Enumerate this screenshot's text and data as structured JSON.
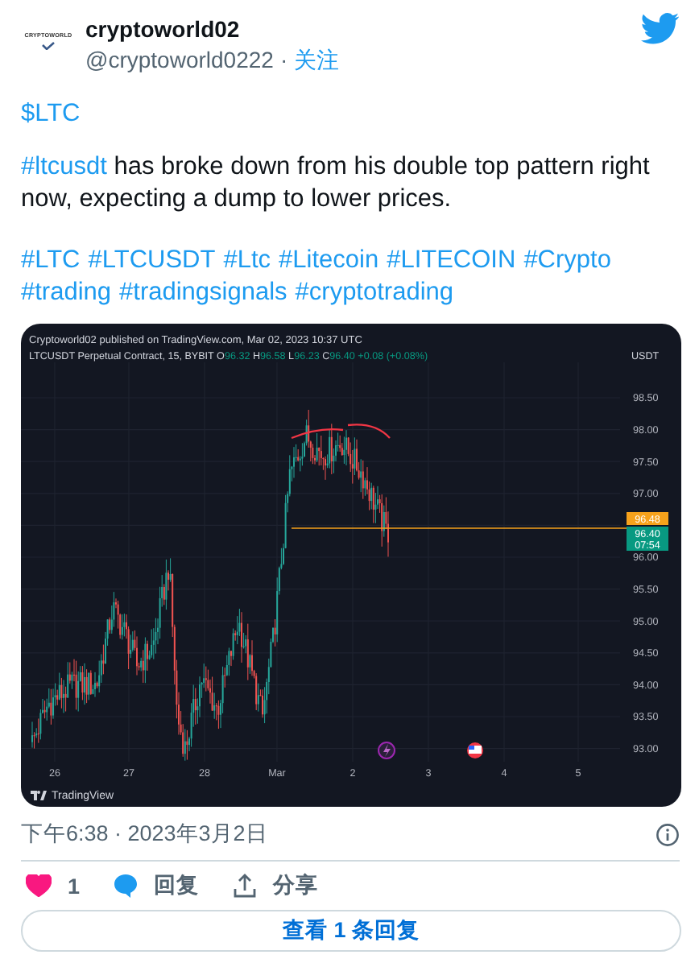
{
  "author": {
    "avatar_text": "CRYPTOWORLD",
    "name": "cryptoworld02",
    "handle": "@cryptoworld0222",
    "separator": "·",
    "follow": "关注"
  },
  "body": {
    "cashtag": "$LTC",
    "mention_tag": "#ltcusdt",
    "text": " has broke down from his double top pattern right now, expecting a dump to lower prices.",
    "hashtags": [
      "#LTC",
      "#LTCUSDT",
      "#Ltc",
      "#Litecoin",
      "#LITECOIN",
      "#Crypto",
      "#trading",
      "#tradingsignals",
      "#cryptotrading"
    ]
  },
  "chart": {
    "published": "Cryptoworld02 published on TradingView.com, Mar 02, 2023 10:37 UTC",
    "symbol": "LTCUSDT Perpetual Contract, 15, BYBIT",
    "ohlc": [
      {
        "label": "O",
        "value": "96.32"
      },
      {
        "label": "H",
        "value": "96.58"
      },
      {
        "label": "L",
        "value": "96.23"
      },
      {
        "label": "C",
        "value": "96.40"
      }
    ],
    "change": "+0.08 (+0.08%)",
    "currency": "USDT",
    "yticks": [
      "98.50",
      "98.00",
      "97.50",
      "97.00",
      "96.00",
      "95.50",
      "95.00",
      "94.50",
      "94.00",
      "93.50",
      "93.00"
    ],
    "xticks": [
      "26",
      "27",
      "28",
      "Mar",
      "2",
      "3",
      "4",
      "5"
    ],
    "price_tags": [
      {
        "text": "96.48",
        "color": "#f7a21b"
      },
      {
        "text": "96.40",
        "color": "#089981"
      },
      {
        "text": "07:54",
        "color": "#089981"
      }
    ],
    "footer": "TradingView"
  },
  "timestamp": "下午6:38 · 2023年3月2日",
  "actions": [
    {
      "kind": "like",
      "label": "1",
      "liked": true
    },
    {
      "kind": "reply",
      "label": "回复"
    },
    {
      "kind": "share",
      "label": "分享"
    }
  ],
  "replies_button": "查看 1 条回复"
}
